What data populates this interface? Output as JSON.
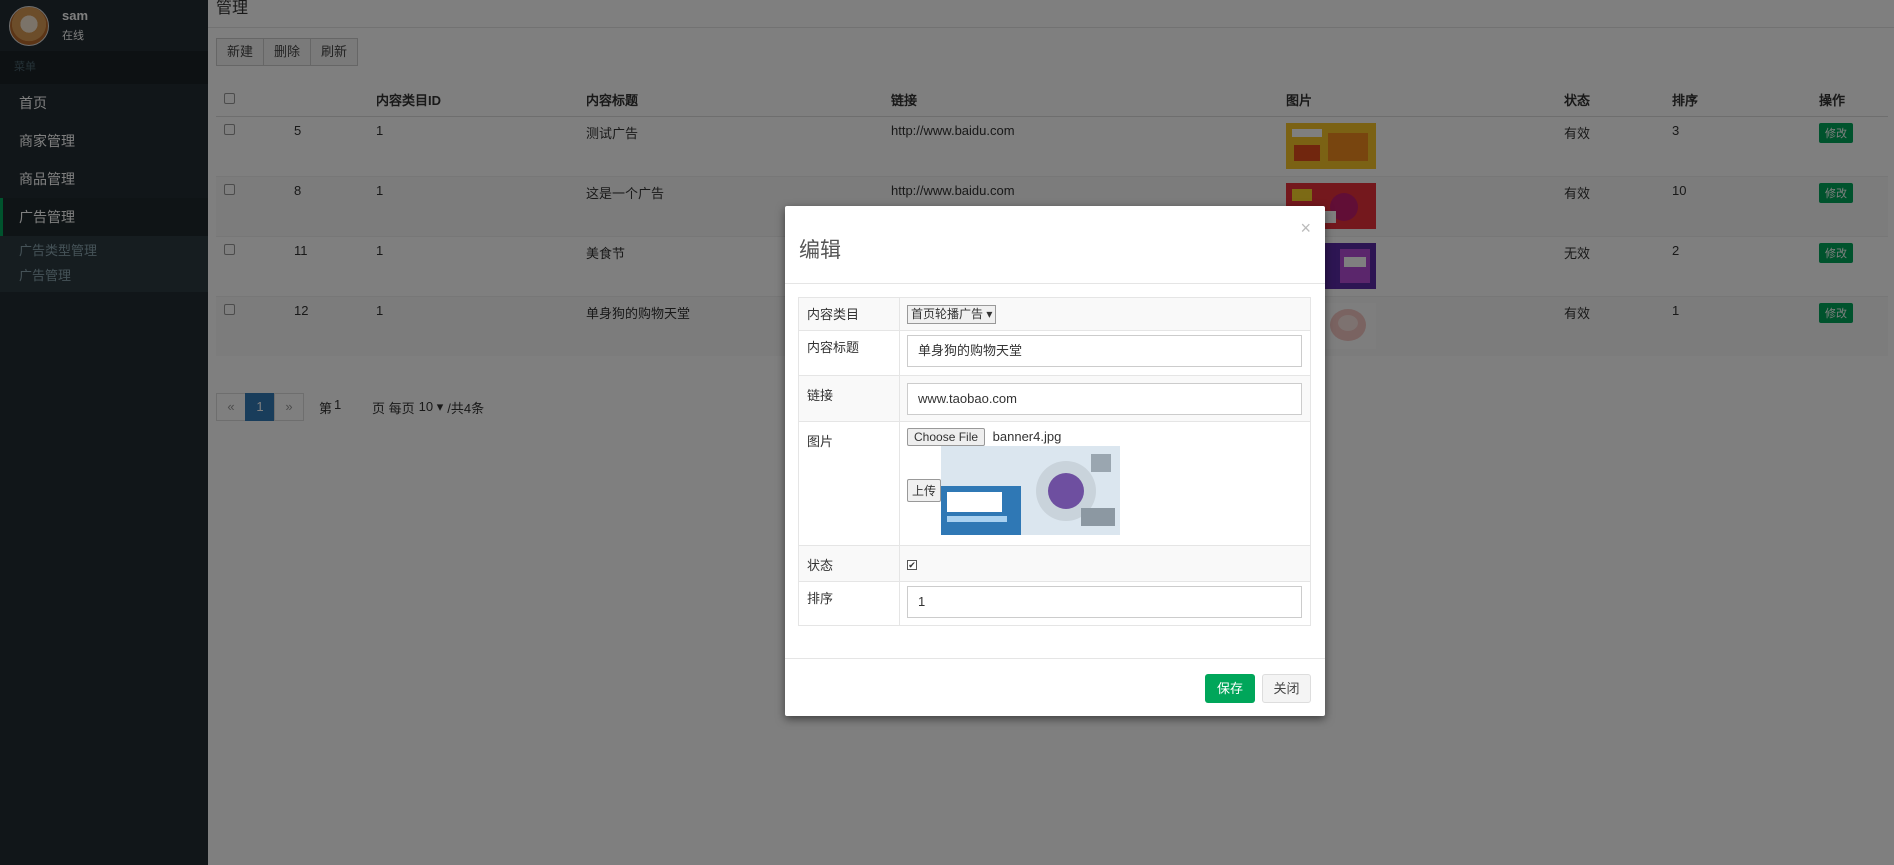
{
  "user": {
    "name": "sam",
    "status": "在线"
  },
  "sidebar": {
    "header": "菜单",
    "items": [
      {
        "label": "首页"
      },
      {
        "label": "商家管理"
      },
      {
        "label": "商品管理"
      },
      {
        "label": "广告管理"
      }
    ],
    "submenu": [
      {
        "label": "广告类型管理"
      },
      {
        "label": "广告管理"
      }
    ]
  },
  "page": {
    "title": "管理"
  },
  "toolbar": {
    "new_label": "新建",
    "delete_label": "删除",
    "refresh_label": "刷新"
  },
  "table": {
    "headers": [
      "",
      "",
      "内容类目ID",
      "内容标题",
      "链接",
      "图片",
      "状态",
      "排序",
      "操作"
    ],
    "rows": [
      {
        "id": "5",
        "category": "1",
        "title": "测试广告",
        "link": "http://www.baidu.com",
        "status": "有效",
        "sort": "3",
        "action": "修改"
      },
      {
        "id": "8",
        "category": "1",
        "title": "这是一个广告",
        "link": "http://www.baidu.com",
        "status": "有效",
        "sort": "10",
        "action": "修改"
      },
      {
        "id": "11",
        "category": "1",
        "title": "美食节",
        "link": "",
        "status": "无效",
        "sort": "2",
        "action": "修改"
      },
      {
        "id": "12",
        "category": "1",
        "title": "单身狗的购物天堂",
        "link": "",
        "status": "有效",
        "sort": "1",
        "action": "修改"
      }
    ]
  },
  "pager": {
    "prev": "«",
    "page": "1",
    "next": "»",
    "page_prefix": "第",
    "page_value": "1",
    "per_page_label": "页 每页",
    "per_page_value": "10",
    "total": "/共4条"
  },
  "modal": {
    "title": "编辑",
    "close": "×",
    "fields": {
      "category_label": "内容类目",
      "category_value": "首页轮播广告",
      "title_label": "内容标题",
      "title_value": "单身狗的购物天堂",
      "link_label": "链接",
      "link_value": "www.taobao.com",
      "image_label": "图片",
      "choose_file": "Choose File",
      "file_name": "banner4.jpg",
      "upload": "上传",
      "status_label": "状态",
      "sort_label": "排序",
      "sort_value": "1"
    },
    "save": "保存",
    "close_button": "关闭"
  },
  "colors": {
    "sidebar_bg": "#222d32",
    "accent_green": "#00a65a",
    "pager_active": "#337ab7"
  },
  "icons": {
    "close": "close-icon",
    "checkbox": "checkbox-icon"
  }
}
